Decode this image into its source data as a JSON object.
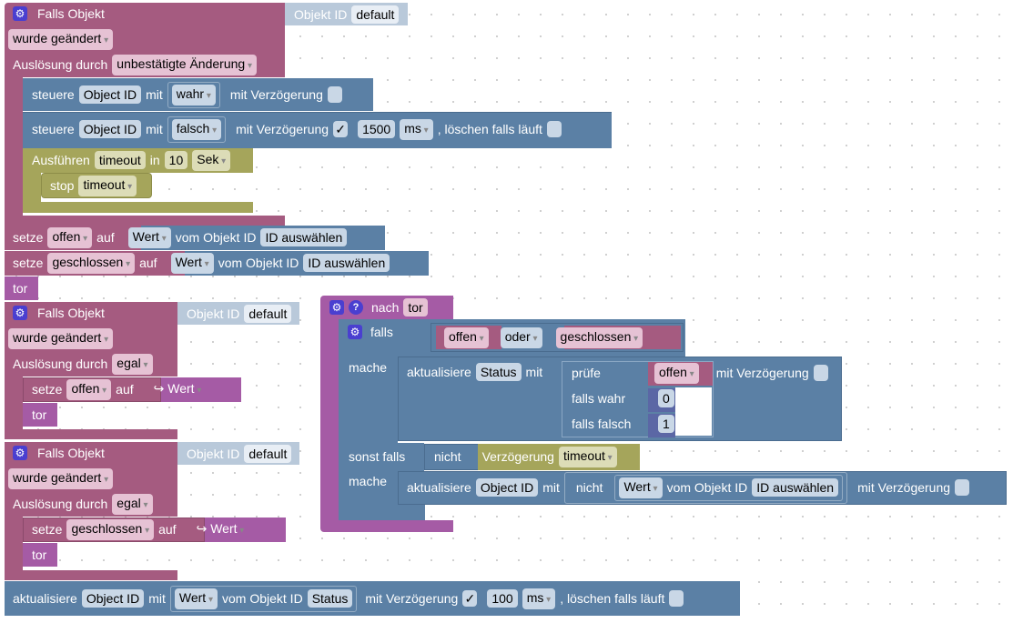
{
  "colors": {
    "trigger": "#a55b80",
    "action": "#5b80a5",
    "timer": "#a5a55b",
    "function": "#a55ba5",
    "objekt_id": "#b9c9da"
  },
  "trigger1": {
    "title": "Falls Objekt",
    "objekt_id_label": "Objekt ID",
    "objekt_id_value": "default",
    "event": "wurde geändert",
    "trigger_label": "Auslösung durch",
    "trigger_value": "unbestätigte Änderung"
  },
  "control1": {
    "label": "steuere",
    "id": "Object ID",
    "mit": "mit",
    "value": "wahr",
    "delay_label": "mit Verzögerung",
    "delay_checked": false
  },
  "control2": {
    "label": "steuere",
    "id": "Object ID",
    "mit": "mit",
    "value": "falsch",
    "delay_label": "mit Verzögerung",
    "delay_checked": true,
    "delay": "1500",
    "unit": "ms",
    "clear_label": ", löschen falls läuft",
    "clear_checked": false
  },
  "timeout": {
    "label": "Ausführen",
    "name": "timeout",
    "in": "in",
    "value": "10",
    "unit": "Sek"
  },
  "stop": {
    "label": "stop",
    "name": "timeout"
  },
  "set_offen": {
    "label": "setze",
    "var": "offen",
    "auf": "auf",
    "value": "Wert",
    "from": "vom Objekt ID",
    "id": "ID auswählen"
  },
  "set_geschlossen": {
    "label": "setze",
    "var": "geschlossen",
    "auf": "auf",
    "value": "Wert",
    "from": "vom Objekt ID",
    "id": "ID auswählen"
  },
  "call_tor1": {
    "label": "tor"
  },
  "trigger2": {
    "title": "Falls Objekt",
    "objekt_id_label": "Objekt ID",
    "objekt_id_value": "default",
    "event": "wurde geändert",
    "trigger_label": "Auslösung durch",
    "trigger_value": "egal",
    "set_label": "setze",
    "set_var": "offen",
    "auf": "auf",
    "value": "↪ Wert",
    "call": "tor"
  },
  "trigger3": {
    "title": "Falls Objekt",
    "objekt_id_label": "Objekt ID",
    "objekt_id_value": "default",
    "event": "wurde geändert",
    "trigger_label": "Auslösung durch",
    "trigger_value": "egal",
    "set_label": "setze",
    "set_var": "geschlossen",
    "auf": "auf",
    "value": "↪ Wert",
    "call": "tor"
  },
  "update_bottom": {
    "label": "aktualisiere",
    "id": "Object ID",
    "mit": "mit",
    "value": "Wert",
    "from": "vom Objekt ID",
    "src": "Status",
    "delay_label": "mit Verzögerung",
    "delay_checked": true,
    "delay": "100",
    "unit": "ms",
    "clear_label": ", löschen falls läuft",
    "clear_checked": false
  },
  "func": {
    "label": "nach",
    "name": "tor",
    "if_label": "falls",
    "a": "offen",
    "op": "oder",
    "b": "geschlossen",
    "do_label": "mache",
    "upd1": {
      "label": "aktualisiere",
      "id": "Status",
      "mit": "mit",
      "check": "prüfe",
      "var": "offen",
      "if_true": "falls wahr",
      "true_val": "0",
      "if_false": "falls falsch",
      "false_val": "1",
      "delay_label": "mit Verzögerung",
      "delay_checked": false
    },
    "elseif_label": "sonst falls",
    "not_label": "nicht",
    "delay_block": "Verzögerung",
    "delay_name": "timeout",
    "do2_label": "mache",
    "upd2": {
      "label": "aktualisiere",
      "id": "Object ID",
      "mit": "mit",
      "not_label": "nicht",
      "value": "Wert",
      "from": "vom Objekt ID",
      "src": "ID auswählen",
      "delay_label": "mit Verzögerung",
      "delay_checked": false
    }
  }
}
